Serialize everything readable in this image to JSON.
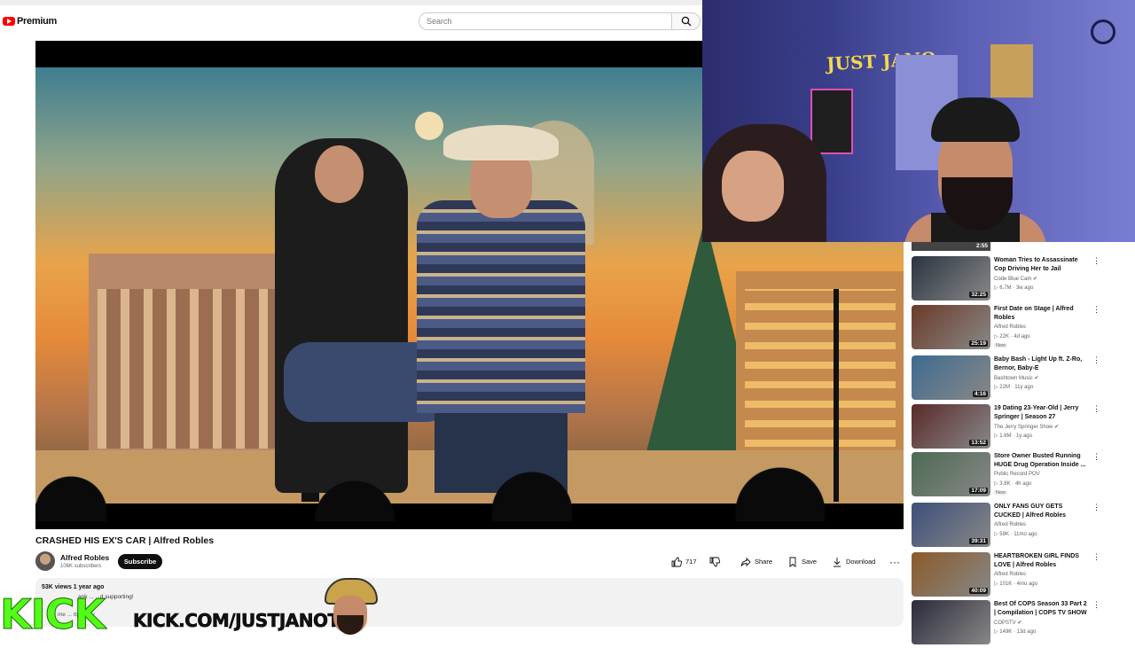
{
  "header": {
    "logo_text": "Premium",
    "search_placeholder": "Search"
  },
  "video": {
    "title": "CRASHED HIS EX'S CAR | Alfred Robles",
    "channel": "Alfred Robles",
    "subscribers": "106K subscribers",
    "subscribe_label": "Subscribe",
    "likes": "717",
    "share_label": "Share",
    "save_label": "Save",
    "download_label": "Download",
    "more_label": "···",
    "views_date": "53K views  1 year ago",
    "desc_line1": "ank ... ...d supporting!",
    "desc_line2": "me me ... ttps://wv"
  },
  "overlay": {
    "kick_logo": "KICK",
    "kick_url": "KICK.COM/JUSTJANOTV"
  },
  "webcam": {
    "wall_sign": "JUST JANO"
  },
  "sidebar": {
    "top_duration": "2:55",
    "items": [
      {
        "title": "Woman Tries to Assassinate Cop Driving Her to Jail",
        "channel": "Code Blue Cam ✔",
        "stats": "▷ 6.7M · 3w ago",
        "duration": "32:25",
        "new": "",
        "color": "#2a3440"
      },
      {
        "title": "First Date on Stage | Alfred Robles",
        "channel": "Alfred Robles",
        "stats": "▷ 22K · 4d ago",
        "duration": "25:19",
        "new": "New",
        "color": "#6b3a28"
      },
      {
        "title": "Baby Bash - Light Up ft. Z-Ro, Bernor, Baby-E",
        "channel": "Bashtown Music ✔",
        "stats": "▷ 22M · 11y ago",
        "duration": "4:16",
        "new": "",
        "color": "#3e6a8f"
      },
      {
        "title": "19 Dating 23-Year-Old | Jerry Springer | Season 27",
        "channel": "The Jerry Springer Show ✔",
        "stats": "▷ 1.6M · 1y ago",
        "duration": "13:52",
        "new": "",
        "color": "#5a2a2a"
      },
      {
        "title": "Store Owner Busted Running HUGE Drug Operation Inside ...",
        "channel": "Public Record POV",
        "stats": "▷ 3.8K · 4h ago",
        "duration": "17:09",
        "new": "New",
        "color": "#4d6a52"
      },
      {
        "title": "ONLY FANS GUY GETS CUCKED | Alfred Robles",
        "channel": "Alfred Robles",
        "stats": "▷ 59K · 11mo ago",
        "duration": "39:31",
        "new": "",
        "color": "#3d4f7a"
      },
      {
        "title": "HEARTBROKEN GIRL FINDS LOVE | Alfred Robles",
        "channel": "Alfred Robles",
        "stats": "▷ 101K · 4mo ago",
        "duration": "40:09",
        "new": "",
        "color": "#8a5a2a"
      },
      {
        "title": "Best Of COPS Season 33 Part 2 | Compilation | COPS TV SHOW",
        "channel": "COPSTV ✔",
        "stats": "▷ 149K · 13d ago",
        "duration": "",
        "new": "",
        "color": "#2a2a3a"
      }
    ]
  }
}
